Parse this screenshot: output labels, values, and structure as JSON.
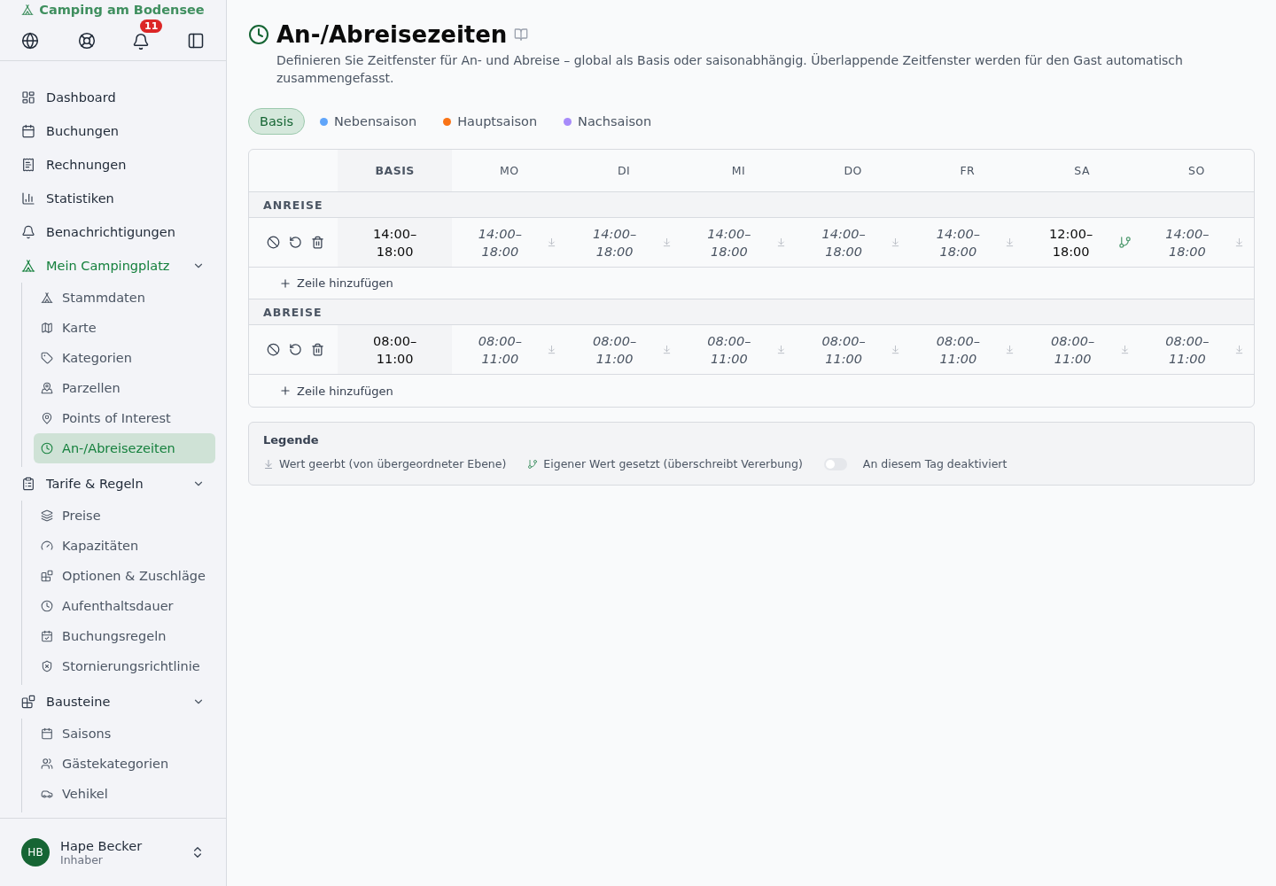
{
  "sidebar": {
    "brand": "Camping am Bodensee",
    "notification_badge": "11",
    "nav": [
      {
        "label": "Dashboard",
        "selected": false
      },
      {
        "label": "Buchungen",
        "selected": false
      },
      {
        "label": "Rechnungen",
        "selected": false
      },
      {
        "label": "Statistiken",
        "selected": false
      },
      {
        "label": "Benachrichtigungen",
        "selected": false
      },
      {
        "label": "Mein Campingplatz",
        "selected": true,
        "expanded": true,
        "children": [
          {
            "label": "Stammdaten",
            "selected": false
          },
          {
            "label": "Karte",
            "selected": false
          },
          {
            "label": "Kategorien",
            "selected": false
          },
          {
            "label": "Parzellen",
            "selected": false
          },
          {
            "label": "Points of Interest",
            "selected": false
          },
          {
            "label": "An-/Abreisezeiten",
            "selected": true
          }
        ]
      },
      {
        "label": "Tarife & Regeln",
        "selected": false,
        "expanded": true,
        "children": [
          {
            "label": "Preise",
            "selected": false
          },
          {
            "label": "Kapazitäten",
            "selected": false
          },
          {
            "label": "Optionen & Zuschläge",
            "selected": false
          },
          {
            "label": "Aufenthaltsdauer",
            "selected": false
          },
          {
            "label": "Buchungsregeln",
            "selected": false
          },
          {
            "label": "Stornierungsrichtlinie",
            "selected": false
          }
        ]
      },
      {
        "label": "Bausteine",
        "selected": false,
        "expanded": true,
        "children": [
          {
            "label": "Saisons",
            "selected": false
          },
          {
            "label": "Gästekategorien",
            "selected": false
          },
          {
            "label": "Vehikel",
            "selected": false
          }
        ]
      }
    ],
    "user": {
      "initials": "HB",
      "name": "Hape Becker",
      "role": "Inhaber"
    }
  },
  "page": {
    "title": "An-/Abreisezeiten",
    "description": "Definieren Sie Zeitfenster für An- und Abreise – global als Basis oder saisonabhängig. Überlappende Zeitfenster werden für den Gast automatisch zusammengefasst.",
    "season_tabs": [
      {
        "label": "Basis",
        "selected": true
      },
      {
        "label": "Nebensaison",
        "selected": false,
        "color": "#60a5fa"
      },
      {
        "label": "Hauptsaison",
        "selected": false,
        "color": "#f97316"
      },
      {
        "label": "Nachsaison",
        "selected": false,
        "color": "#a78bfa"
      }
    ],
    "table": {
      "columns": [
        "BASIS",
        "MO",
        "DI",
        "MI",
        "DO",
        "FR",
        "SA",
        "SO"
      ],
      "sections": [
        {
          "label": "ANREISE",
          "add_label": "Zeile hinzufügen",
          "rows": [
            {
              "basis": "14:00–18:00",
              "days": [
                {
                  "value": "14:00–18:00",
                  "inherited": true
                },
                {
                  "value": "14:00–18:00",
                  "inherited": true
                },
                {
                  "value": "14:00–18:00",
                  "inherited": true
                },
                {
                  "value": "14:00–18:00",
                  "inherited": true
                },
                {
                  "value": "14:00–18:00",
                  "inherited": true
                },
                {
                  "value": "12:00–18:00",
                  "inherited": false
                },
                {
                  "value": "14:00–18:00",
                  "inherited": true
                }
              ]
            }
          ]
        },
        {
          "label": "ABREISE",
          "add_label": "Zeile hinzufügen",
          "rows": [
            {
              "basis": "08:00–11:00",
              "days": [
                {
                  "value": "08:00–11:00",
                  "inherited": true
                },
                {
                  "value": "08:00–11:00",
                  "inherited": true
                },
                {
                  "value": "08:00–11:00",
                  "inherited": true
                },
                {
                  "value": "08:00–11:00",
                  "inherited": true
                },
                {
                  "value": "08:00–11:00",
                  "inherited": true
                },
                {
                  "value": "08:00–11:00",
                  "inherited": true
                },
                {
                  "value": "08:00–11:00",
                  "inherited": true
                }
              ]
            }
          ]
        }
      ]
    },
    "legend": {
      "title": "Legende",
      "items": [
        {
          "kind": "inherited",
          "label": "Wert geerbt (von übergeordneter Ebene)"
        },
        {
          "kind": "override",
          "label": "Eigener Wert gesetzt (überschreibt Vererbung)"
        },
        {
          "kind": "toggle",
          "label": "An diesem Tag deaktiviert",
          "on": false
        }
      ]
    }
  }
}
